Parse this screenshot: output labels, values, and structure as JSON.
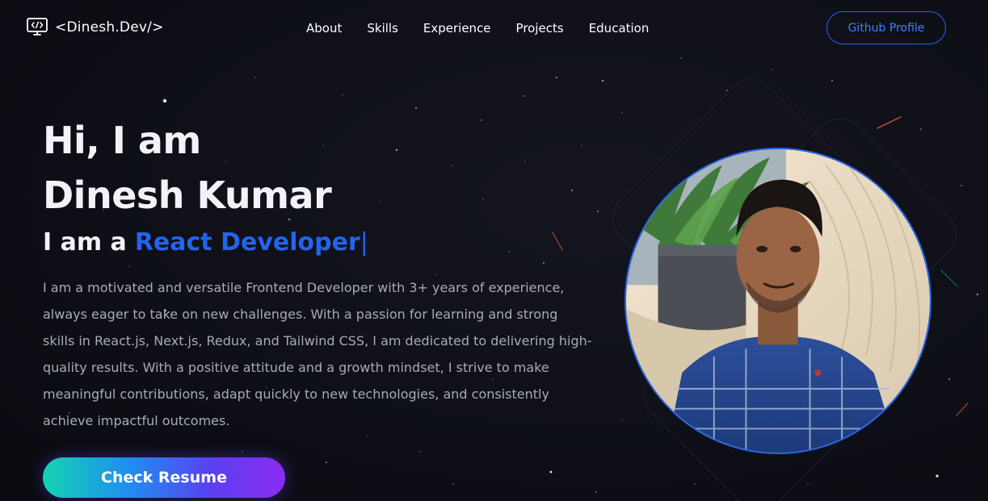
{
  "header": {
    "logo_text": "<Dinesh.Dev/>",
    "logo_icon": "monitor-code-icon",
    "nav": [
      {
        "label": "About"
      },
      {
        "label": "Skills"
      },
      {
        "label": "Experience"
      },
      {
        "label": "Projects"
      },
      {
        "label": "Education"
      }
    ],
    "github_button": "Github Profile"
  },
  "hero": {
    "greeting": "Hi, I am",
    "name": "Dinesh Kumar",
    "role_prefix": "I am a",
    "role_value": "React Developer",
    "caret": "|",
    "bio": "I am a motivated and versatile Frontend Developer with 3+ years of experience, always eager to take on new challenges. With a passion for learning and strong skills in React.js, Next.js, Redux, and Tailwind CSS, I am dedicated to delivering high-quality results. With a positive attitude and a growth mindset, I strive to make meaningful contributions, adapt quickly to new technologies, and consistently achieve impactful outcomes.",
    "resume_button": "Check Resume"
  },
  "colors": {
    "background": "#0f1017",
    "accent": "#2563eb",
    "text": "#f1f3f8",
    "muted_text": "#a7abb7",
    "button_gradient_start": "#14d3b0",
    "button_gradient_end": "#8b2cf5"
  }
}
